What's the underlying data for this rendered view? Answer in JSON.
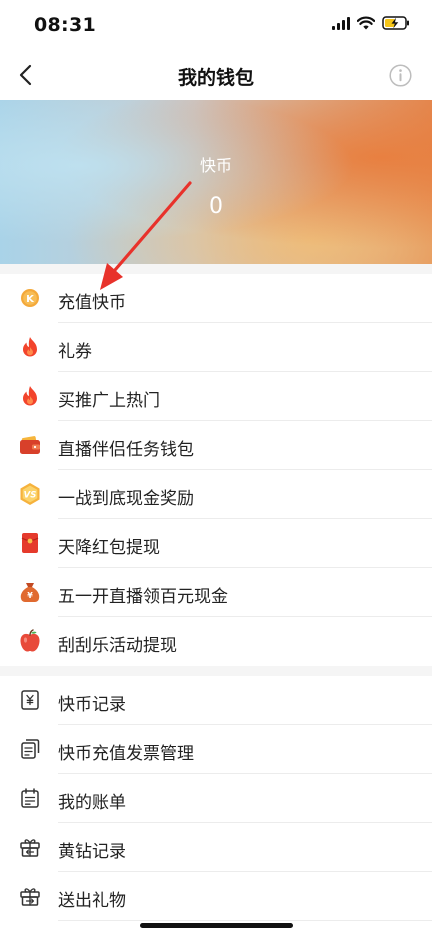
{
  "status_bar": {
    "time": "08:31"
  },
  "nav": {
    "title": "我的钱包"
  },
  "balance": {
    "label": "快币",
    "value": "0"
  },
  "menu_primary": [
    {
      "label": "充值快币",
      "icon": "k-coin-icon"
    },
    {
      "label": "礼券",
      "icon": "flame-icon"
    },
    {
      "label": "买推广上热门",
      "icon": "flame-icon"
    },
    {
      "label": "直播伴侣任务钱包",
      "icon": "wallet-icon"
    },
    {
      "label": "一战到底现金奖励",
      "icon": "vs-badge-icon"
    },
    {
      "label": "天降红包提现",
      "icon": "red-envelope-icon"
    },
    {
      "label": "五一开直播领百元现金",
      "icon": "money-bag-icon"
    },
    {
      "label": "刮刮乐活动提现",
      "icon": "apple-icon"
    }
  ],
  "menu_secondary": [
    {
      "label": "快币记录",
      "icon": "yuan-record-icon"
    },
    {
      "label": "快币充值发票管理",
      "icon": "invoice-icon"
    },
    {
      "label": "我的账单",
      "icon": "calendar-bill-icon"
    },
    {
      "label": "黄钻记录",
      "icon": "gift-box-icon"
    },
    {
      "label": "送出礼物",
      "icon": "gift-send-icon"
    }
  ],
  "colors": {
    "accent_orange": "#f29a2e",
    "flame_red": "#f2442c",
    "arrow_red": "#e8322b"
  }
}
